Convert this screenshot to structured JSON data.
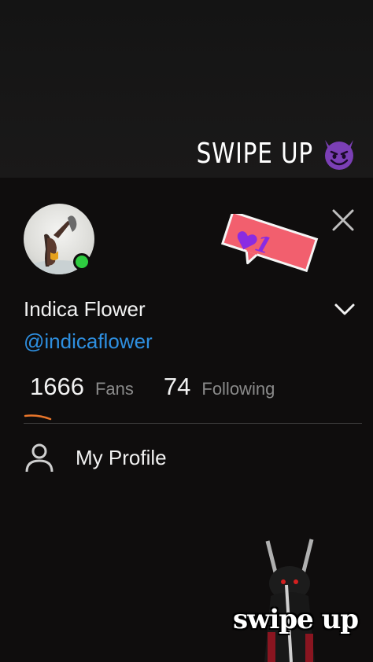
{
  "story": {
    "swipe_up_top": "SWIPE UP",
    "swipe_up_bottom": "swipe up"
  },
  "profile": {
    "display_name": "Indica Flower",
    "handle": "@indicaflower",
    "online": true,
    "fans_count": "1666",
    "fans_label": "Fans",
    "following_count": "74",
    "following_label": "Following"
  },
  "notification": {
    "likes_count": "1"
  },
  "menu": {
    "my_profile_label": "My Profile"
  },
  "icons": {
    "close": "close-icon",
    "chevron": "chevron-down-icon",
    "person": "person-icon",
    "heart": "heart-icon",
    "devil": "devil-emoji-icon"
  },
  "colors": {
    "online": "#2ecc40",
    "handle": "#2e8fe0",
    "sticker": "#f25f6e",
    "heart": "#8a2be2"
  }
}
